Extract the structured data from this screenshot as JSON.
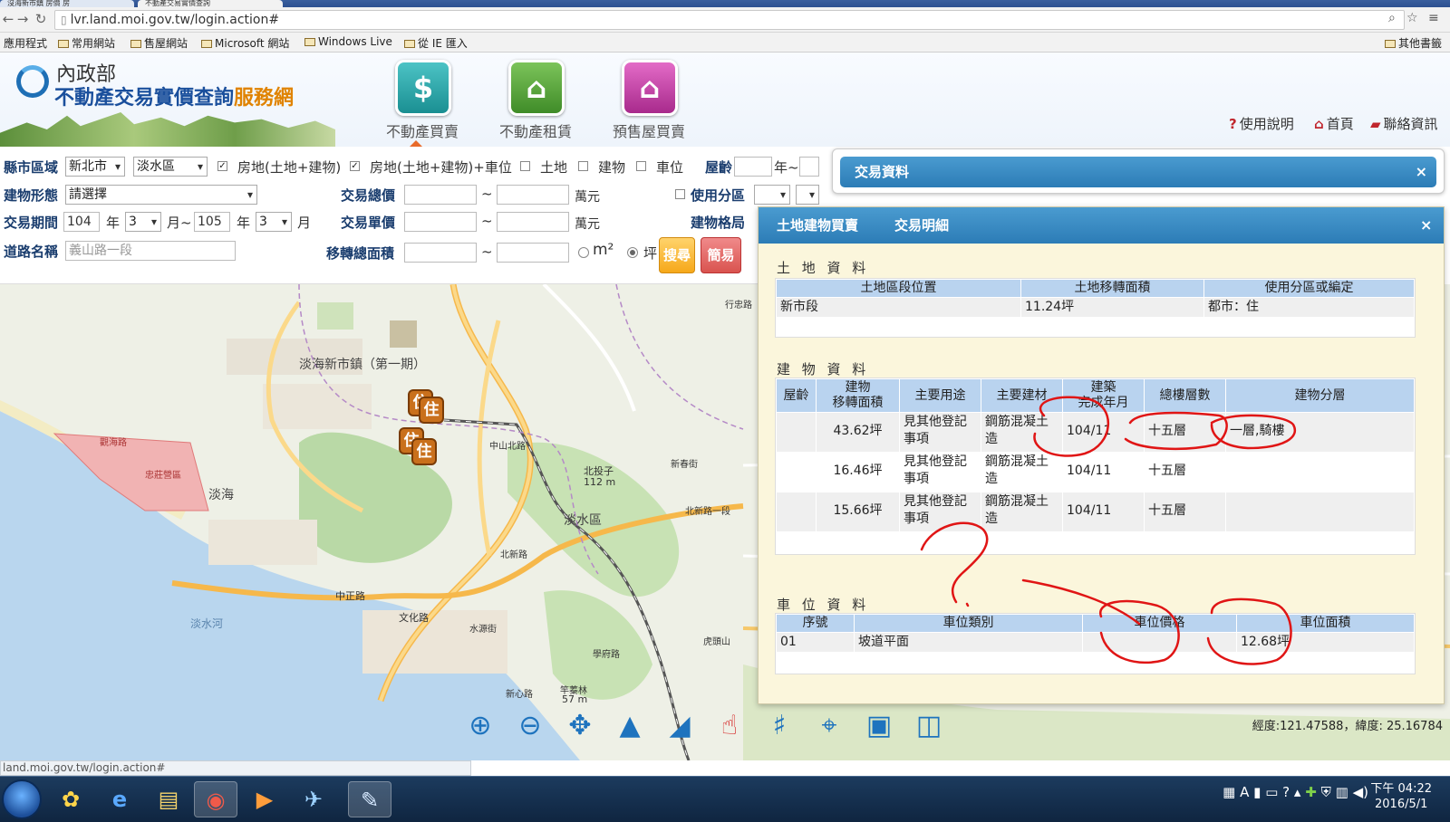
{
  "browser": {
    "tabs": [
      "沒海新市鎮 房價 房",
      "不動產交易實價查詢"
    ],
    "url": "lvr.land.moi.gov.tw/login.action#",
    "bookmarks": [
      "應用程式",
      "常用網站",
      "售屋網站",
      "Microsoft 網站",
      "Windows Live",
      "從 IE 匯入",
      "其他書籤"
    ],
    "status_url": "land.moi.gov.tw/login.action#"
  },
  "site": {
    "ministry": "內政部",
    "title_main": "不動產交易實價查詢",
    "title_accent": "服務網",
    "nav": [
      {
        "label": "不動產買賣",
        "icon": "house-dollar-icon",
        "color": "#2aa6a8"
      },
      {
        "label": "不動產租賃",
        "icon": "house-rent-icon",
        "color": "#5aa63a"
      },
      {
        "label": "預售屋買賣",
        "icon": "building-crane-icon",
        "color": "#c640a8"
      }
    ],
    "links": {
      "help": "使用說明",
      "home": "首頁",
      "contact": "聯絡資訊"
    }
  },
  "form": {
    "county_label": "縣市區域",
    "county": "新北市",
    "district": "淡水區",
    "opt1": "房地(土地+建物)",
    "opt2": "房地(土地+建物)+車位",
    "opt3": "土地",
    "opt4": "建物",
    "opt5": "車位",
    "age_label": "屋齡",
    "age_unit": "年~",
    "type_label": "建物形態",
    "type_value": "請選擇",
    "total_label": "交易總價",
    "unit_wan": "萬元",
    "zoning_label": "使用分區",
    "period_label": "交易期間",
    "year_from": "104",
    "month_from": "3",
    "year_to": "105",
    "month_to": "3",
    "year_unit": "年",
    "month_unit_to": "月~",
    "month_unit": "月",
    "unitprice_label": "交易單價",
    "layout_label": "建物格局",
    "road_label": "道路名稱",
    "road_value": "義山路一段",
    "area_label": "移轉總面積",
    "tilde": "~",
    "unit_m2": "m²",
    "unit_ping": "坪",
    "search_btn": "搜尋",
    "simple_btn": "簡易"
  },
  "map": {
    "labels": [
      "淡海新市鎮（第一期）",
      "觀海路",
      "忠莊營區",
      "淡海",
      "北投子",
      "112 m",
      "淡水區",
      "北新路",
      "中正路",
      "文化路",
      "水源街",
      "學府路",
      "中山北路",
      "新春街",
      "虎頭山",
      "淡水河",
      "行忠路",
      "竿蓁林",
      "57 m",
      "新心路",
      "北新路一段"
    ],
    "marker_char": "住",
    "coords": "經度:121.47588，緯度: 25.16784"
  },
  "panel_top": {
    "title": "交易資料",
    "close": "×"
  },
  "panel_detail": {
    "tab1": "土地建物買賣",
    "tab2": "交易明細",
    "close": "×",
    "land_title": "土 地 資 料",
    "land_headers": [
      "土地區段位置",
      "土地移轉面積",
      "使用分區或編定"
    ],
    "land_rows": [
      [
        "新市段",
        "11.24坪",
        "都市：住"
      ]
    ],
    "building_title": "建 物 資 料",
    "building_headers": [
      "屋齡",
      "建物\n移轉面積",
      "主要用途",
      "主要建材",
      "建築\n完成年月",
      "總樓層數",
      "建物分層"
    ],
    "building_rows": [
      [
        "",
        "43.62坪",
        "見其他登記事項",
        "鋼筋混凝土造",
        "104/11",
        "十五層",
        "一層,騎樓"
      ],
      [
        "",
        "16.46坪",
        "見其他登記事項",
        "鋼筋混凝土造",
        "104/11",
        "十五層",
        ""
      ],
      [
        "",
        "15.66坪",
        "見其他登記事項",
        "鋼筋混凝土造",
        "104/11",
        "十五層",
        ""
      ]
    ],
    "parking_title": "車 位 資 料",
    "parking_headers": [
      "序號",
      "車位類別",
      "車位價格",
      "車位面積"
    ],
    "parking_rows": [
      [
        "01",
        "坡道平面",
        "",
        "12.68坪"
      ]
    ]
  },
  "taskbar": {
    "clock_time": "下午 04:22",
    "clock_date": "2016/5/1",
    "ime": "A"
  }
}
